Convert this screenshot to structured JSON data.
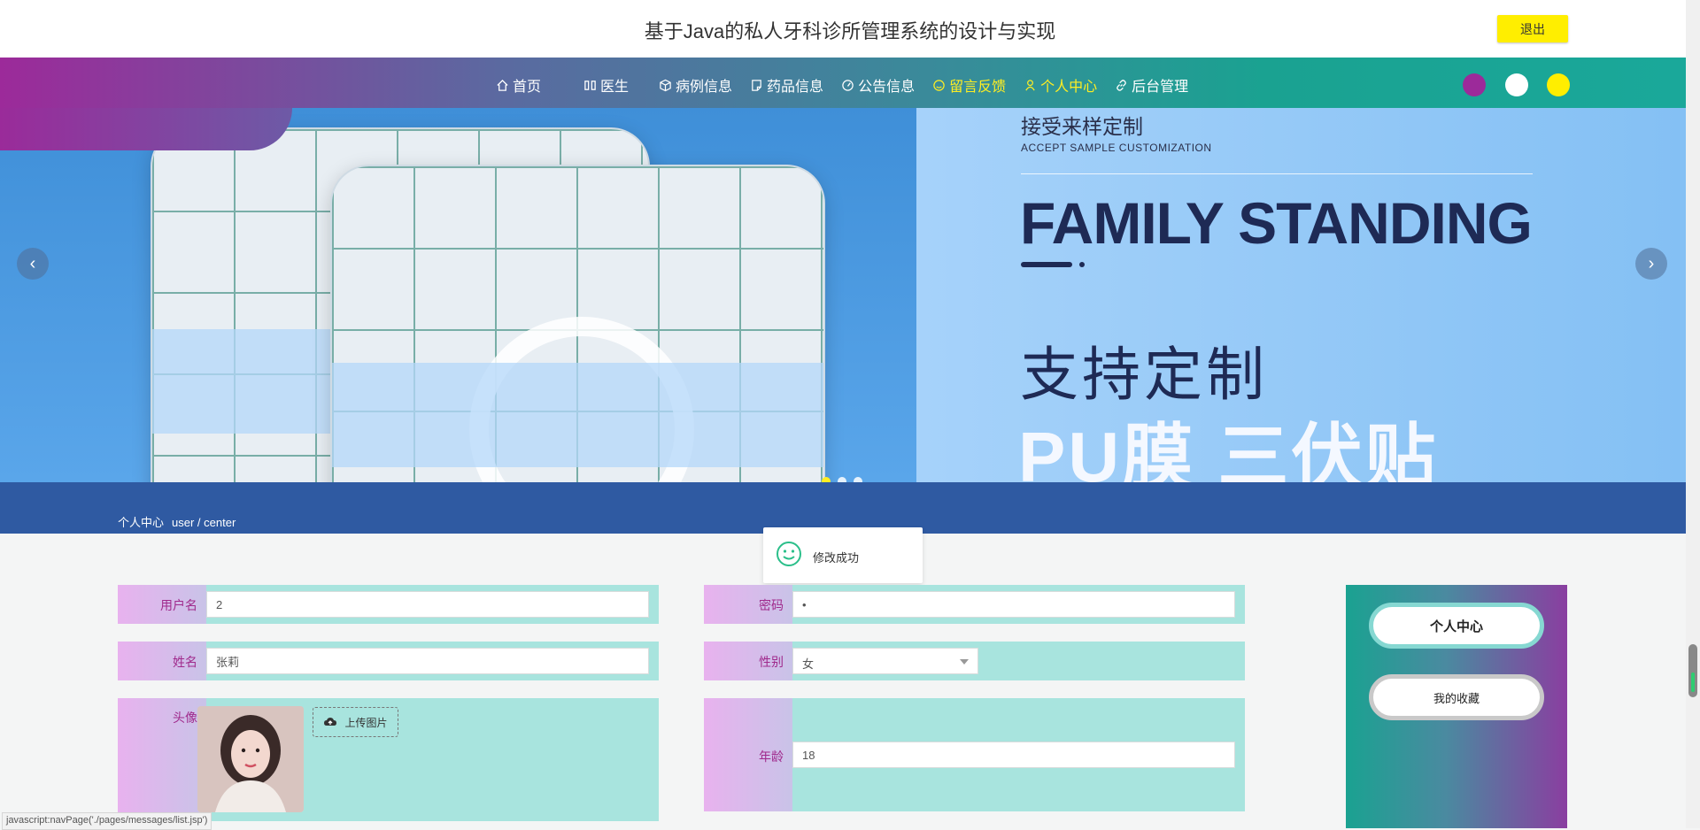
{
  "header": {
    "title": "基于Java的私人牙科诊所管理系统的设计与实现",
    "logout_label": "退出"
  },
  "nav": {
    "items": [
      {
        "label": "首页",
        "icon": "home-icon"
      },
      {
        "label": "医生",
        "icon": "columns-icon"
      },
      {
        "label": "病例信息",
        "icon": "cube-icon"
      },
      {
        "label": "药品信息",
        "icon": "note-icon"
      },
      {
        "label": "公告信息",
        "icon": "gauge-icon"
      },
      {
        "label": "留言反馈",
        "icon": "smile-icon"
      },
      {
        "label": "个人中心",
        "icon": "user-icon"
      },
      {
        "label": "后台管理",
        "icon": "link-icon"
      }
    ],
    "active_index": 6,
    "theme_colors": [
      "#9c2a9a",
      "#ffffff",
      "#ffee00"
    ]
  },
  "banner": {
    "subtitle_cn": "接受来样定制",
    "subtitle_en": "ACCEPT SAMPLE CUSTOMIZATION",
    "headline": "FAMILY STANDING",
    "line_cn_1": "支持定制",
    "line_cn_2": "PU膜 三伏贴",
    "prev_arrow": "‹",
    "next_arrow": "›"
  },
  "breadcrumb": {
    "title": "个人中心",
    "path": "user / center"
  },
  "toast": {
    "message": "修改成功"
  },
  "form": {
    "username_label": "用户名",
    "username_value": "2",
    "password_label": "密码",
    "password_value": "•",
    "name_label": "姓名",
    "name_value": "张莉",
    "gender_label": "性别",
    "gender_value": "女",
    "avatar_label": "头像",
    "upload_label": "上传图片",
    "age_label": "年龄",
    "age_value": "18"
  },
  "sidebar": {
    "items": [
      {
        "label": "个人中心"
      },
      {
        "label": "我的收藏"
      }
    ]
  },
  "status_bar": {
    "url": "javascript:navPage('./pages/messages/list.jsp')"
  },
  "colors": {
    "accent_yellow": "#ffee00",
    "teal": "#1aa291",
    "purple": "#9c2a9a",
    "form_bg": "#a8e4de",
    "label_text": "#a02a8c"
  }
}
